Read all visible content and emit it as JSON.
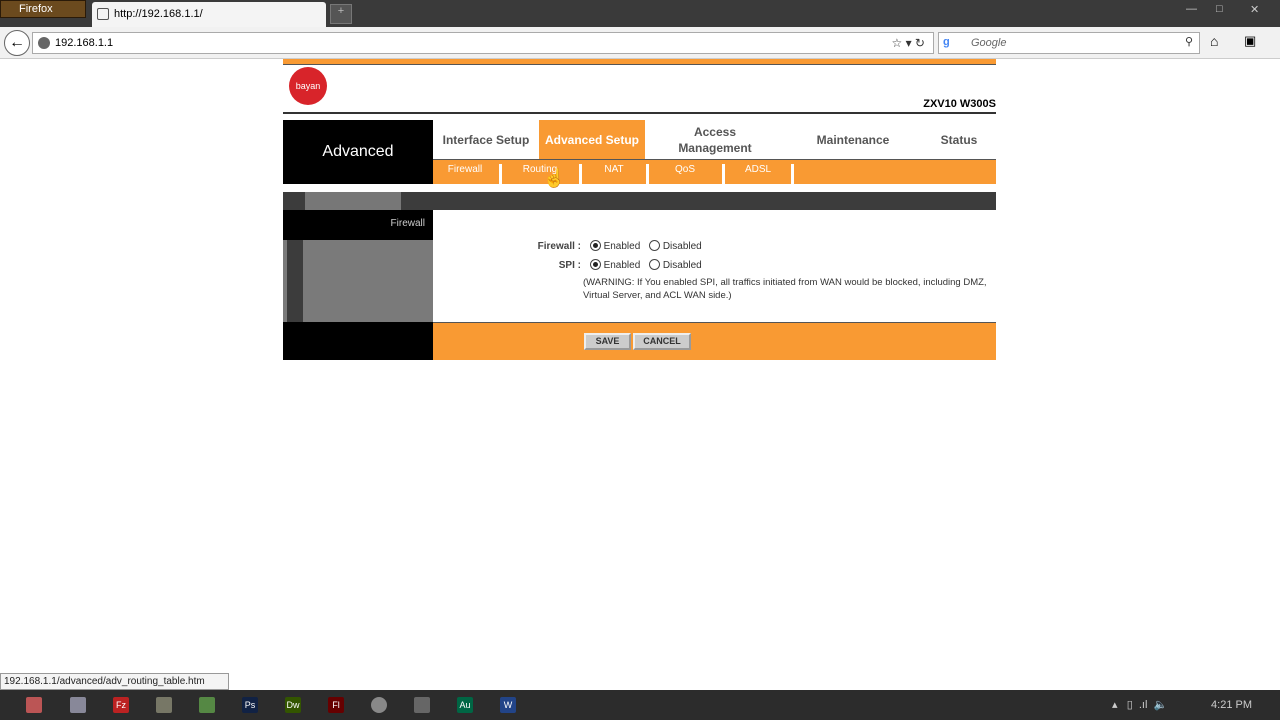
{
  "browser": {
    "app_button": "Firefox",
    "tab_title": "http://192.168.1.1/",
    "address": "192.168.1.1",
    "search_placeholder": "Google",
    "status_url": "192.168.1.1/advanced/adv_routing_table.htm"
  },
  "router": {
    "logo_text": "bayan",
    "model": "ZXV10 W300S",
    "section": "Advanced",
    "main_tabs": [
      {
        "label": "Interface Setup",
        "active": false
      },
      {
        "label": "Advanced Setup",
        "active": true
      },
      {
        "label": "Access Management",
        "active": false
      },
      {
        "label": "Maintenance",
        "active": false
      },
      {
        "label": "Status",
        "active": false
      }
    ],
    "sub_tabs": [
      "Firewall",
      "Routing",
      "NAT",
      "QoS",
      "ADSL"
    ],
    "sidebar_title": "Firewall",
    "form": {
      "firewall_label": "Firewall :",
      "firewall_value": "Enabled",
      "spi_label": "SPI :",
      "spi_value": "Enabled",
      "enabled_label": "Enabled",
      "disabled_label": "Disabled",
      "warning": "(WARNING: If You enabled SPI, all traffics initiated from WAN would be blocked, including DMZ, Virtual Server, and ACL WAN side.)"
    },
    "save_label": "SAVE",
    "cancel_label": "CANCEL"
  },
  "colors": {
    "accent": "#f99a33",
    "dark": "#000000",
    "grey": "#7a7a7a"
  },
  "taskbar": {
    "clock": "4:21 PM",
    "apps": [
      "firefox",
      "file-explorer",
      "filezilla",
      "notepad",
      "archive",
      "photoshop",
      "dreamweaver",
      "flash",
      "chrome",
      "network",
      "audition",
      "word"
    ]
  }
}
